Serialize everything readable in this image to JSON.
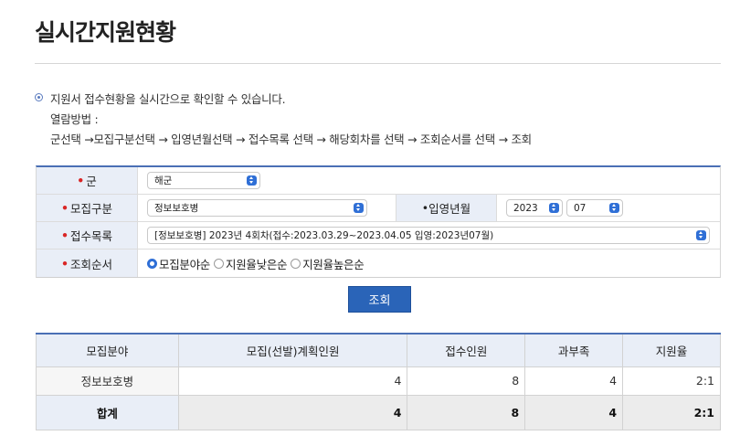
{
  "page": {
    "title": "실시간지원현황"
  },
  "info": {
    "lines": [
      "지원서 접수현황을 실시간으로 확인할 수 있습니다.",
      "열람방법 :",
      "군선택 →모집구분선택 → 입영년월선택 → 접수목록 선택 → 해당회차를 선택 → 조회순서를 선택 → 조회"
    ]
  },
  "form": {
    "branch": {
      "label": "군",
      "value": "해군"
    },
    "category": {
      "label": "모집구분",
      "value": "정보보호병"
    },
    "enlist": {
      "label": "입영년월",
      "year": "2023",
      "month": "07"
    },
    "receipt": {
      "label": "접수목록",
      "value": "[정보보호병] 2023년 4회차(접수:2023.03.29~2023.04.05 입영:2023년07월)"
    },
    "order": {
      "label": "조회순서",
      "options": [
        "모집분야순",
        "지원율낮은순",
        "지원율높은순"
      ],
      "selected_index": 0
    },
    "search_label": "조회"
  },
  "result": {
    "headers": [
      "모집분야",
      "모집(선발)계획인원",
      "접수인원",
      "과부족",
      "지원율"
    ],
    "rows": [
      [
        "정보보호병",
        "4",
        "8",
        "4",
        "2:1"
      ]
    ],
    "total": [
      "합계",
      "4",
      "8",
      "4",
      "2:1"
    ]
  },
  "colors": {
    "accent": "#2a64b8",
    "header_bg": "#e9eef7",
    "required": "#d92626"
  }
}
